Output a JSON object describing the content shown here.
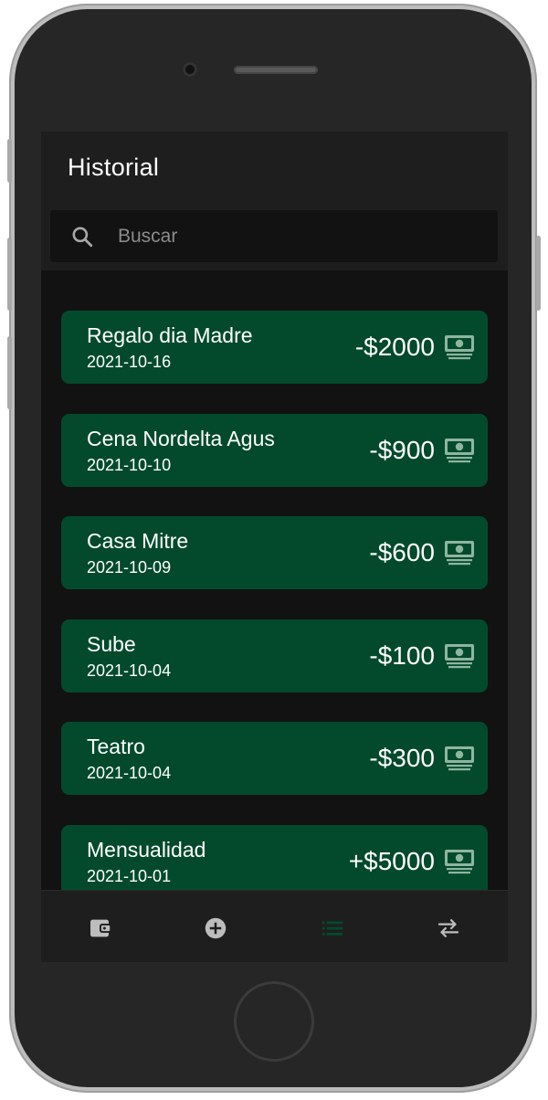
{
  "header": {
    "title": "Historial"
  },
  "search": {
    "placeholder": "Buscar",
    "value": ""
  },
  "transactions": [
    {
      "title": "Regalo dia Madre",
      "date": "2021-10-16",
      "amount": "-$2000"
    },
    {
      "title": "Cena Nordelta Agus",
      "date": "2021-10-10",
      "amount": "-$900"
    },
    {
      "title": "Casa Mitre",
      "date": "2021-10-09",
      "amount": "-$600"
    },
    {
      "title": "Sube",
      "date": "2021-10-04",
      "amount": "-$100"
    },
    {
      "title": "Teatro",
      "date": "2021-10-04",
      "amount": "-$300"
    },
    {
      "title": "Mensualidad",
      "date": "2021-10-01",
      "amount": "+$5000"
    }
  ],
  "bottom_nav": [
    {
      "icon": "wallet-icon",
      "active": false
    },
    {
      "icon": "add-circle-icon",
      "active": false
    },
    {
      "icon": "list-icon",
      "active": true
    },
    {
      "icon": "swap-icon",
      "active": false
    }
  ],
  "colors": {
    "card_background": "#034a2d",
    "active_nav": "#034a2d",
    "inactive_nav": "#bdbdbd",
    "money_icon": "#8fb59e"
  }
}
